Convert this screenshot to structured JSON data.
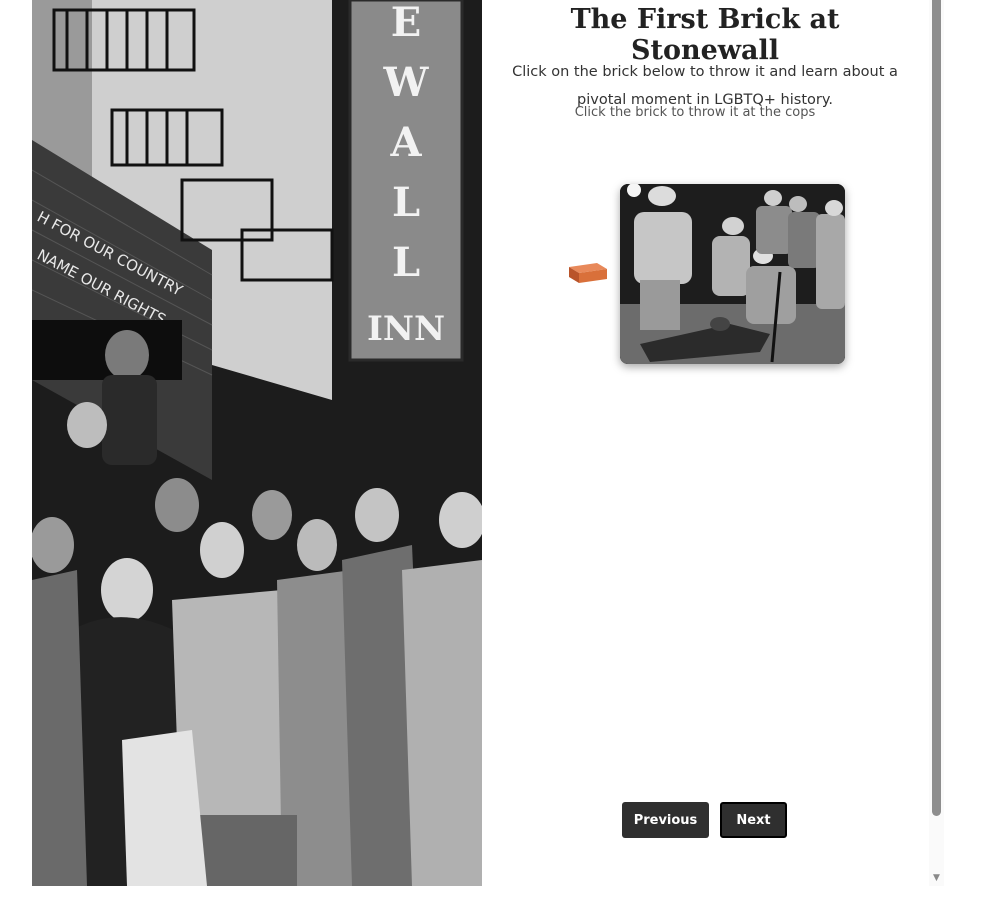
{
  "page": {
    "title": "The First Brick at Stonewall",
    "intro": "Click on the brick below to throw it and learn about a pivotal moment in LGBTQ+ history.",
    "hint": "Click the brick to throw it at the cops"
  },
  "photo_left": {
    "sign_letters": [
      "E",
      "W",
      "A",
      "L",
      "L"
    ],
    "sign_bottom": "INN",
    "wall_text": [
      "H FOR OUR COUNTRY",
      "NAME OUR RIGHTS"
    ]
  },
  "brick": {
    "color": "#d9703a",
    "icon": "brick-icon"
  },
  "navigation": {
    "previous_label": "Previous",
    "next_label": "Next"
  },
  "scrollbar": {
    "down_arrow": "▼"
  }
}
